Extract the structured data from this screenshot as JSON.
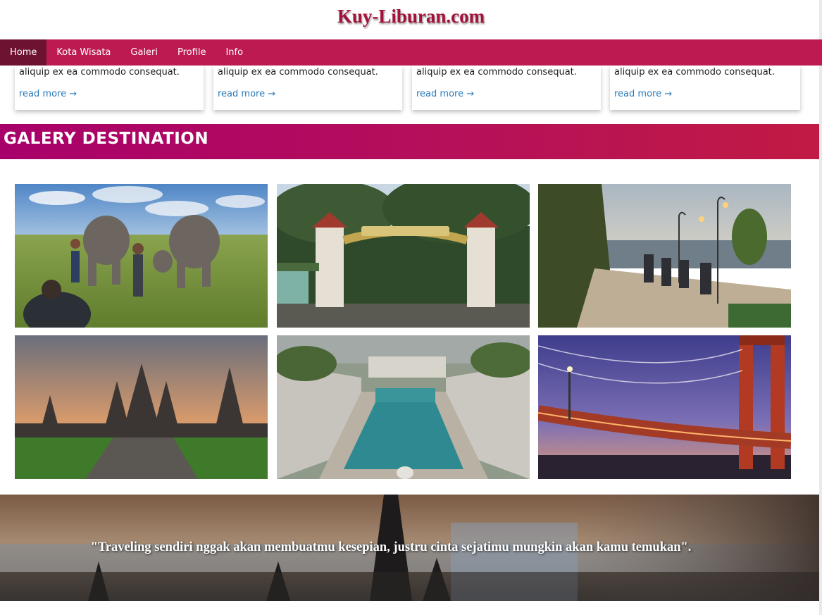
{
  "site": {
    "title": "Kuy-Liburan.com"
  },
  "nav": {
    "items": [
      {
        "label": "Home",
        "active": true
      },
      {
        "label": "Kota Wisata",
        "active": false
      },
      {
        "label": "Galeri",
        "active": false
      },
      {
        "label": "Profile",
        "active": false
      },
      {
        "label": "Info",
        "active": false
      }
    ]
  },
  "cards": [
    {
      "text": "aliquip ex ea commodo consequat.",
      "link": "read more →"
    },
    {
      "text": "aliquip ex ea commodo consequat.",
      "link": "read more →"
    },
    {
      "text": "aliquip ex ea commodo consequat.",
      "link": "read more →"
    },
    {
      "text": "aliquip ex ea commodo consequat.",
      "link": "read more →"
    }
  ],
  "gallery": {
    "title": "GALERY DESTINATION",
    "photos": [
      {
        "name": "elephant-park-photo"
      },
      {
        "name": "way-kambas-gate-photo"
      },
      {
        "name": "hillside-cafe-photo"
      },
      {
        "name": "prambanan-temple-photo"
      },
      {
        "name": "taman-sari-pool-photo"
      },
      {
        "name": "river-bridge-photo"
      }
    ]
  },
  "quote": {
    "text": "\"Traveling sendiri nggak akan membuatmu kesepian, justru cinta sejatimu mungkin akan kamu temukan\"."
  },
  "colors": {
    "brand": "#bd1a52",
    "nav_active": "#6e1231",
    "title": "#a3123a",
    "link": "#2a7ab8"
  }
}
